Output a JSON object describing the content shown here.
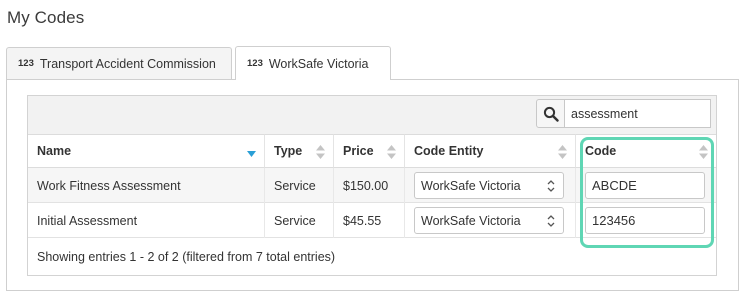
{
  "page": {
    "title": "My Codes"
  },
  "tabs": [
    {
      "num": "123",
      "label": "Transport Accident Commission",
      "active": false
    },
    {
      "num": "123",
      "label": "WorkSafe Victoria",
      "active": true
    }
  ],
  "search": {
    "value": "assessment",
    "icon": "search-icon"
  },
  "table": {
    "columns": [
      "Name",
      "Type",
      "Price",
      "Code Entity",
      "Code"
    ],
    "rows": [
      {
        "name": "Work Fitness Assessment",
        "type": "Service",
        "price": "$150.00",
        "entity": "WorkSafe Victoria",
        "code": "ABCDE"
      },
      {
        "name": "Initial Assessment",
        "type": "Service",
        "price": "$45.55",
        "entity": "WorkSafe Victoria",
        "code": "123456"
      }
    ],
    "footer": "Showing entries 1 - 2 of 2 (filtered from 7 total entries)"
  },
  "colors": {
    "highlight": "#5fd6b4",
    "sort_active": "#2a9fd6"
  }
}
